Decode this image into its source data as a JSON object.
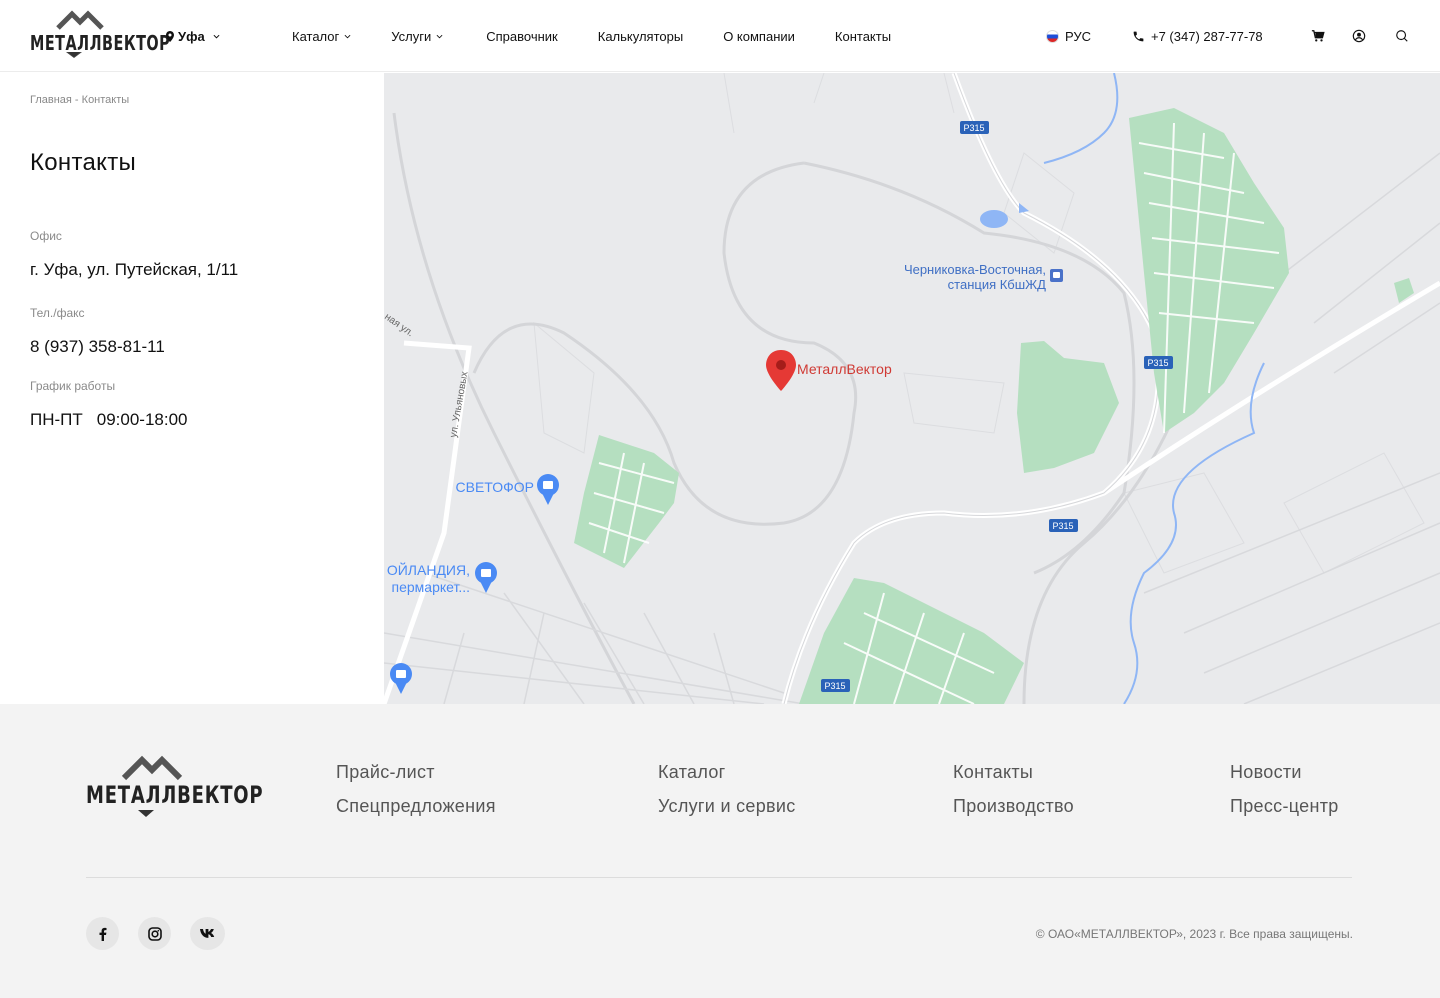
{
  "header": {
    "logo_text": "МЕТАЛЛВЕКТОР",
    "city": "Уфа",
    "nav": [
      {
        "label": "Каталог"
      },
      {
        "label": "Услуги"
      },
      {
        "label": "Справочник"
      },
      {
        "label": "Калькуляторы"
      },
      {
        "label": "О компании"
      },
      {
        "label": "Контакты"
      }
    ],
    "language": "РУС",
    "phone": "+7 (347) 287-77-78"
  },
  "breadcrumb": {
    "home": "Главная",
    "separator": " - ",
    "current": "Контакты"
  },
  "contacts": {
    "title": "Контакты",
    "office_label": "Офис",
    "office_value": "г. Уфа, ул. Путейская, 1/11",
    "phone_label": "Тел./факс",
    "phone_value": "8 (937) 358-81-11",
    "hours_label": "График работы",
    "hours_days": "ПН-ПТ",
    "hours_time": "09:00-18:00"
  },
  "map": {
    "marker_label": "МеталлВектор",
    "road_labels": [
      "Р315",
      "Р315",
      "Р315",
      "Р315"
    ],
    "station_line1": "Черниковка-Восточная,",
    "station_line2": "станция КбшЖД",
    "store1": "СВЕТОФОР",
    "store2_line1": "ОЙЛАНДИЯ,",
    "store2_line2": "пермаркет...",
    "street1": "ул. Ульяновых",
    "street2": "ная ул."
  },
  "footer": {
    "logo_text": "МЕТАЛЛВЕКТОР",
    "col1": [
      "Прайс-лист",
      "Спецпредложения"
    ],
    "col2": [
      "Каталог",
      "Услуги и сервис"
    ],
    "col3": [
      "Контакты",
      "Производство"
    ],
    "col4": [
      "Новости",
      "Пресс-центр"
    ],
    "copyright": "© ОАО«МЕТАЛЛВЕКТОР», 2023 г. Все права защищены."
  },
  "colors": {
    "park_green": "#b5dfc0",
    "marker_red": "#e53935",
    "water_blue": "#8fb6f5",
    "road_badge": "#2a62b8",
    "poi_blue": "#4a8af4"
  }
}
